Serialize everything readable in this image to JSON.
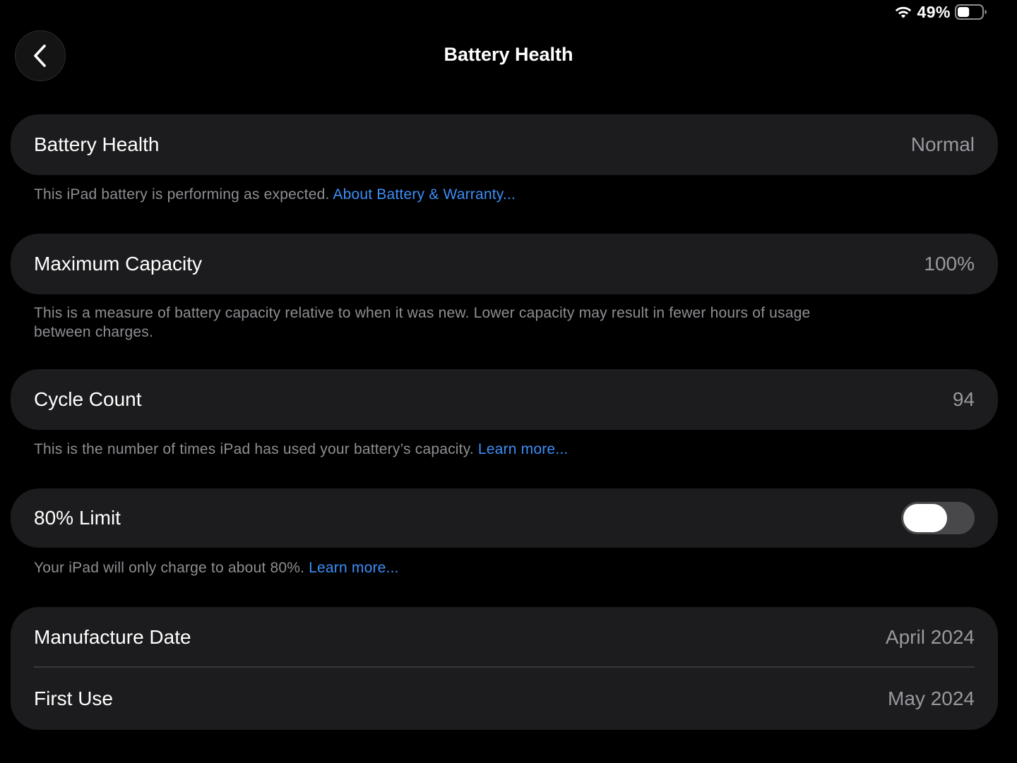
{
  "status_bar": {
    "wifi_icon": "wifi-icon",
    "battery_percent": "49%",
    "battery_icon": "battery-icon",
    "battery_level": 0.49
  },
  "nav": {
    "back_icon": "chevron-left-icon",
    "title": "Battery Health"
  },
  "sections": {
    "battery_health": {
      "label": "Battery Health",
      "value": "Normal",
      "footer_text": "This iPad battery is performing as expected. ",
      "footer_link": "About Battery & Warranty..."
    },
    "maximum_capacity": {
      "label": "Maximum Capacity",
      "value": "100%",
      "footer_text": "This is a measure of battery capacity relative to when it was new. Lower capacity may result in fewer hours of usage between charges."
    },
    "cycle_count": {
      "label": "Cycle Count",
      "value": "94",
      "footer_text": "This is the number of times iPad has used your battery’s capacity. ",
      "footer_link": "Learn more..."
    },
    "limit_80": {
      "label": "80% Limit",
      "toggle_on": false,
      "footer_text": "Your iPad will only charge to about 80%. ",
      "footer_link": "Learn more..."
    },
    "dates": {
      "manufacture_label": "Manufacture Date",
      "manufacture_value": "April 2024",
      "first_use_label": "First Use",
      "first_use_value": "May 2024"
    }
  },
  "colors": {
    "background": "#000000",
    "cell": "#1c1c1e",
    "link": "#3d8ef7",
    "secondary_text": "#8e8e93",
    "toggle_off": "#48484a"
  }
}
